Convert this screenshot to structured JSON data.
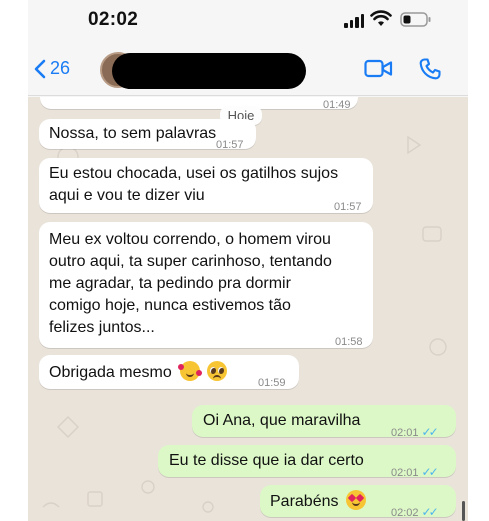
{
  "status_bar": {
    "time": "02:02"
  },
  "header": {
    "back_count": "26",
    "icons": {
      "back": "chevron-left-icon",
      "video": "video-camera-icon",
      "call": "phone-icon"
    }
  },
  "chat": {
    "date_separator": "Hoje",
    "top_partial_time": "01:49",
    "messages": [
      {
        "direction": "incoming",
        "text": "Nossa, to sem palavras",
        "time": "01:57"
      },
      {
        "direction": "incoming",
        "lines": [
          "Eu estou chocada, usei os gatilhos sujos",
          "aqui e vou te dizer viu"
        ],
        "time": "01:57"
      },
      {
        "direction": "incoming",
        "lines": [
          "Meu ex voltou correndo, o homem virou",
          "outro aqui, ta super carinhoso, tentando",
          "me agradar, ta pedindo pra dormir",
          "comigo hoje, nunca estivemos tão",
          "felizes juntos..."
        ],
        "time": "01:58"
      },
      {
        "direction": "incoming",
        "text": "Obrigada mesmo",
        "emojis": [
          "smiling-face-with-hearts",
          "pleading-face"
        ],
        "time": "01:59"
      },
      {
        "direction": "outgoing",
        "text": "Oi Ana, que maravilha",
        "time": "02:01",
        "status": "read"
      },
      {
        "direction": "outgoing",
        "text": "Eu te disse que ia dar certo",
        "time": "02:01",
        "status": "read"
      },
      {
        "direction": "outgoing",
        "text": "Parabéns",
        "emojis": [
          "smiling-face-with-heart-eyes"
        ],
        "time": "02:02",
        "status": "read"
      }
    ]
  },
  "colors": {
    "accent": "#1a7cf4",
    "outgoing_bubble": "#dcf8c7",
    "incoming_bubble": "#ffffff",
    "chat_background": "#e9e3da",
    "read_ticks": "#4fb6ec"
  }
}
